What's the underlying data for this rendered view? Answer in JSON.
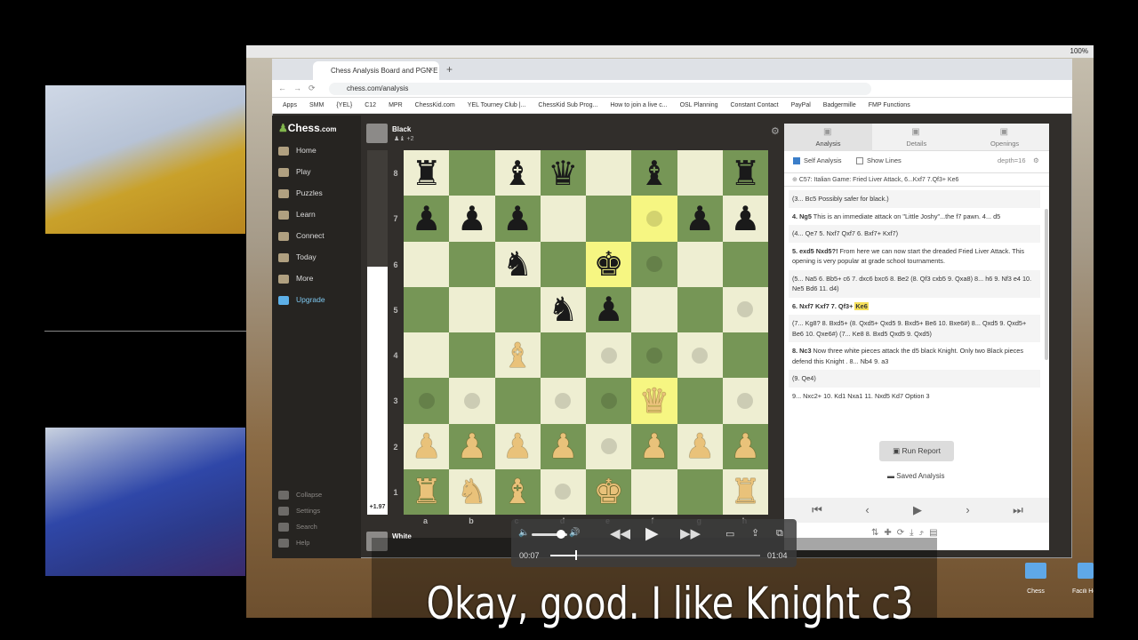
{
  "browser": {
    "tab_title": "Chess Analysis Board and PGN E",
    "tab_close": "×",
    "new_tab": "+",
    "url": "chess.com/analysis",
    "bookmarks": [
      "Apps",
      "SMM",
      "{YEL}",
      "C12",
      "MPR",
      "ChessKid.com",
      "YEL Tourney Club |...",
      "ChessKid Sub Prog...",
      "How to join a live c...",
      "OSL Planning",
      "Constant Contact",
      "PayPal",
      "Badgermille",
      "FMP Functions"
    ],
    "mac_status": "100%"
  },
  "sidenav": {
    "logo": "Chess",
    "logo_suffix": ".com",
    "items": [
      {
        "label": "Home",
        "icon": "home-icon"
      },
      {
        "label": "Play",
        "icon": "play-icon"
      },
      {
        "label": "Puzzles",
        "icon": "puzzle-icon"
      },
      {
        "label": "Learn",
        "icon": "learn-icon"
      },
      {
        "label": "Connect",
        "icon": "chat-icon"
      },
      {
        "label": "Today",
        "icon": "today-icon"
      },
      {
        "label": "More",
        "icon": "more-icon"
      },
      {
        "label": "Upgrade",
        "icon": "diamond-icon"
      }
    ],
    "bottom": [
      {
        "label": "Collapse",
        "icon": "collapse-icon"
      },
      {
        "label": "Settings",
        "icon": "gear-icon"
      },
      {
        "label": "Search",
        "icon": "search-icon"
      },
      {
        "label": "Help",
        "icon": "help-icon"
      }
    ]
  },
  "players": {
    "top_name": "Black",
    "top_captured": "+2",
    "bottom_name": "White"
  },
  "eval": {
    "value": "+1.97",
    "white_fraction": 0.68
  },
  "board": {
    "rank_labels": [
      "8",
      "7",
      "6",
      "5",
      "4",
      "3",
      "2",
      "1"
    ],
    "file_labels": [
      "a",
      "b",
      "c",
      "d",
      "e",
      "f",
      "g",
      "h"
    ],
    "position": [
      [
        "r",
        "",
        "b",
        "q",
        "",
        "b",
        "",
        "r"
      ],
      [
        "p",
        "p",
        "p",
        "",
        "",
        "",
        "p",
        "p"
      ],
      [
        "",
        "",
        "n",
        "",
        "k",
        "",
        "",
        ""
      ],
      [
        "",
        "",
        "",
        "n",
        "p",
        "",
        "",
        ""
      ],
      [
        "",
        "",
        "B",
        "",
        "",
        "",
        "",
        ""
      ],
      [
        "",
        "",
        "",
        "",
        "",
        "Q",
        "",
        ""
      ],
      [
        "P",
        "P",
        "P",
        "P",
        "",
        "P",
        "P",
        "P"
      ],
      [
        "R",
        "N",
        "B",
        "",
        "K",
        "",
        "",
        "R"
      ]
    ],
    "dots": [
      "f7",
      "f6",
      "e5",
      "h5",
      "e4",
      "f4",
      "g4",
      "a3",
      "b3",
      "d3",
      "e3",
      "h3",
      "e2",
      "d1"
    ],
    "highlights": [
      "f7",
      "e6",
      "f3"
    ]
  },
  "analysis": {
    "tabs": [
      {
        "label": "Analysis",
        "icon": "analysis-icon"
      },
      {
        "label": "Details",
        "icon": "info-icon"
      },
      {
        "label": "Openings",
        "icon": "book-icon"
      }
    ],
    "self_analysis": "Self Analysis",
    "show_lines": "Show Lines",
    "depth": "depth=16",
    "opening": "C57: Italian Game: Fried Liver Attack, 6...Kxf7 7.Qf3+ Ke6",
    "notes": [
      {
        "bold": "",
        "text": "(3... Bc5 Possibly safer for black.)"
      },
      {
        "bold": "4. Ng5",
        "text": " This is an immediate attack on \"Little Joshy\"...the f7 pawn. 4... d5"
      },
      {
        "bold": "",
        "text": "(4... Qe7 5. Nxf7 Qxf7 6. Bxf7+ Kxf7)"
      },
      {
        "bold": "5. exd5 Nxd5?!",
        "text": " From here we can now start the dreaded Fried Liver Attack. This opening is very popular at grade school tournaments."
      },
      {
        "bold": "",
        "text": "(5... Na5 6. Bb5+ c6 7. dxc6 bxc6 8. Be2 (8. Qf3 cxb5 9. Qxa8)  8... h6 9. Nf3 e4 10. Ne5 Bd6 11. d4)"
      },
      {
        "bold": "6. Nxf7 Kxf7 7. Qf3+",
        "text": "",
        "mark": "Ke6"
      },
      {
        "bold": "",
        "text": "(7... Kg8? 8. Bxd5+ (8. Qxd5+ Qxd5 9. Bxd5+ Be6 10. Bxe6#)  8... Qxd5 9. Qxd5+ Be6 10. Qxe6#) (7... Ke8 8. Bxd5 Qxd5 9. Qxd5)"
      },
      {
        "bold": "8. Nc3",
        "text": " Now three white pieces attack the d5 black Knight. Only two Black pieces defend this Knight . 8... Nb4 9. a3"
      },
      {
        "bold": "",
        "text": "(9. Qe4)"
      },
      {
        "bold": "",
        "text": "9... Nxc2+ 10. Kd1 Nxa1 11. Nxd5 Kd7 Option 3"
      }
    ],
    "run_report": "Run Report",
    "saved_analysis": "Saved Analysis",
    "nav": [
      "⏮",
      "‹",
      "▶",
      "›",
      "⏭"
    ]
  },
  "video": {
    "current_time": "00:07",
    "end_time": "01:04",
    "progress_fraction": 0.12
  },
  "desktop": {
    "icons": [
      {
        "label": "Chess"
      },
      {
        "label": "Facili Holid"
      }
    ]
  },
  "subtitle": "Okay, good. I like Knight c3"
}
